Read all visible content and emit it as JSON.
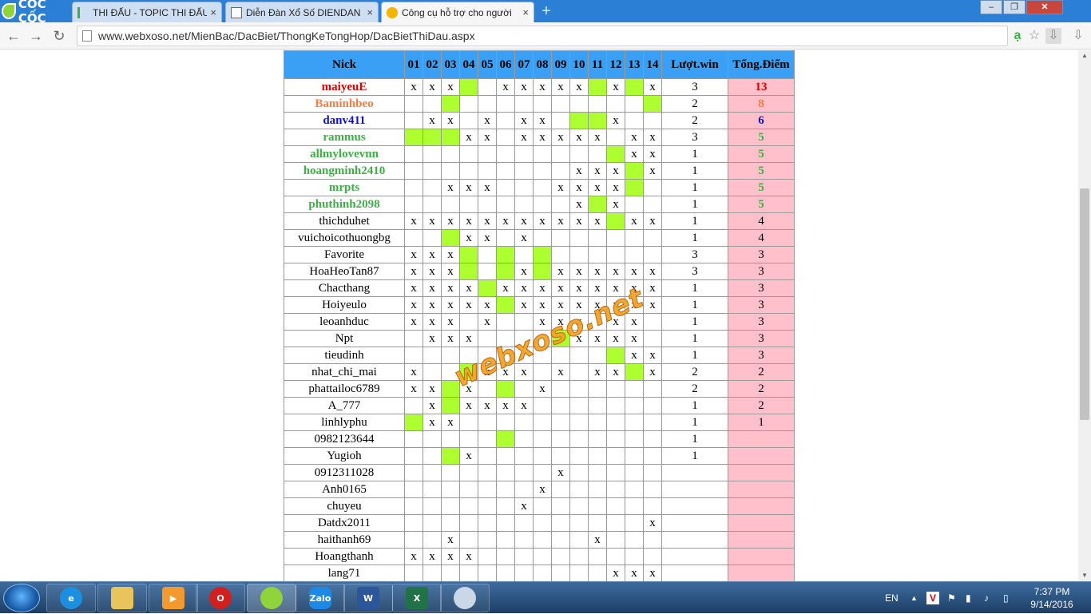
{
  "browser": {
    "brand": "CỐC CỐC",
    "tabs": [
      {
        "title": "THI ĐẤU - TOPIC THI ĐẤU",
        "close": "×"
      },
      {
        "title": "Diễn Đàn Xổ Số DIENDAN",
        "close": "×"
      },
      {
        "title": "Công cụ hỗ trợ cho người",
        "close": "×"
      }
    ],
    "new_tab": "+",
    "url": "www.webxoso.net/MienBac/DacBiet/ThongKeTongHop/DacBietThiDau.aspx",
    "window_controls": {
      "minimize": "–",
      "maximize": "❐",
      "close": "✕"
    }
  },
  "table": {
    "headers": {
      "nick": "Nick",
      "days": [
        "01",
        "02",
        "03",
        "04",
        "05",
        "06",
        "07",
        "08",
        "09",
        "10",
        "11",
        "12",
        "13",
        "14"
      ],
      "wins": "Lượt.win",
      "points": "Tổng.Điểm"
    },
    "rows": [
      {
        "nick": "maiyeuE",
        "color": "#e00000",
        "bold": true,
        "cells": [
          "x",
          "x",
          "x",
          "G",
          "",
          "x",
          "x",
          "x",
          "x",
          "x",
          "G",
          "x",
          "G",
          "x"
        ],
        "wins": "3",
        "points": "13"
      },
      {
        "nick": "Baminhbeo",
        "color": "#ff7a3d",
        "bold": true,
        "cells": [
          "",
          "",
          "G",
          "",
          "",
          "",
          "",
          "",
          "",
          "",
          "",
          "",
          "",
          "G"
        ],
        "wins": "2",
        "points": "8"
      },
      {
        "nick": "danv411",
        "color": "#1010c8",
        "bold": true,
        "cells": [
          "",
          "x",
          "x",
          "",
          "x",
          "",
          "x",
          "x",
          "",
          "G",
          "G",
          "x",
          "",
          ""
        ],
        "wins": "2",
        "points": "6"
      },
      {
        "nick": "rammus",
        "color": "#3cb043",
        "bold": true,
        "cells": [
          "G",
          "G",
          "G",
          "x",
          "x",
          "",
          "x",
          "x",
          "x",
          "x",
          "x",
          "",
          "x",
          "x"
        ],
        "wins": "3",
        "points": "5"
      },
      {
        "nick": "allmylovevnn",
        "color": "#3cb043",
        "bold": true,
        "cells": [
          "",
          "",
          "",
          "",
          "",
          "",
          "",
          "",
          "",
          "",
          "",
          "G",
          "x",
          "x"
        ],
        "wins": "1",
        "points": "5"
      },
      {
        "nick": "hoangminh2410",
        "color": "#3cb043",
        "bold": true,
        "cells": [
          "",
          "",
          "",
          "",
          "",
          "",
          "",
          "",
          "",
          "x",
          "x",
          "x",
          "G",
          "x"
        ],
        "wins": "1",
        "points": "5"
      },
      {
        "nick": "mrpts",
        "color": "#3cb043",
        "bold": true,
        "cells": [
          "",
          "",
          "x",
          "x",
          "x",
          "",
          "",
          "",
          "x",
          "x",
          "x",
          "x",
          "G",
          ""
        ],
        "wins": "1",
        "points": "5"
      },
      {
        "nick": "phuthinh2098",
        "color": "#3cb043",
        "bold": true,
        "cells": [
          "",
          "",
          "",
          "",
          "",
          "",
          "",
          "",
          "",
          "x",
          "G",
          "x",
          "",
          ""
        ],
        "wins": "1",
        "points": "5"
      },
      {
        "nick": "thichduhet",
        "color": "#000",
        "bold": false,
        "cells": [
          "x",
          "x",
          "x",
          "x",
          "x",
          "x",
          "x",
          "x",
          "x",
          "x",
          "x",
          "G",
          "x",
          "x"
        ],
        "wins": "1",
        "points": "4"
      },
      {
        "nick": "vuichoicothuongbg",
        "color": "#000",
        "bold": false,
        "cells": [
          "",
          "",
          "G",
          "x",
          "x",
          "",
          "x",
          "",
          "",
          "",
          "",
          "",
          "",
          ""
        ],
        "wins": "1",
        "points": "4"
      },
      {
        "nick": "Favorite",
        "color": "#000",
        "bold": false,
        "cells": [
          "x",
          "x",
          "x",
          "G",
          "",
          "G",
          "",
          "G",
          "",
          "",
          "",
          "",
          "",
          ""
        ],
        "wins": "3",
        "points": "3"
      },
      {
        "nick": "HoaHeoTan87",
        "color": "#000",
        "bold": false,
        "cells": [
          "x",
          "x",
          "x",
          "G",
          "",
          "G",
          "x",
          "G",
          "x",
          "x",
          "x",
          "x",
          "x",
          "x"
        ],
        "wins": "3",
        "points": "3"
      },
      {
        "nick": "Chacthang",
        "color": "#000",
        "bold": false,
        "cells": [
          "x",
          "x",
          "x",
          "x",
          "G",
          "x",
          "x",
          "x",
          "x",
          "x",
          "x",
          "x",
          "x",
          "x"
        ],
        "wins": "1",
        "points": "3"
      },
      {
        "nick": "Hoiyeulo",
        "color": "#000",
        "bold": false,
        "cells": [
          "x",
          "x",
          "x",
          "x",
          "x",
          "G",
          "x",
          "x",
          "x",
          "x",
          "x",
          "x",
          "x",
          "x"
        ],
        "wins": "1",
        "points": "3"
      },
      {
        "nick": "leoanhduc",
        "color": "#000",
        "bold": false,
        "cells": [
          "x",
          "x",
          "x",
          "",
          "x",
          "",
          "",
          "x",
          "x",
          "x",
          "",
          "x",
          "x",
          ""
        ],
        "wins": "1",
        "points": "3"
      },
      {
        "nick": "Npt",
        "color": "#000",
        "bold": false,
        "cells": [
          "",
          "x",
          "x",
          "x",
          "",
          "",
          "",
          "",
          "G",
          "x",
          "x",
          "x",
          "x",
          ""
        ],
        "wins": "1",
        "points": "3"
      },
      {
        "nick": "tieudinh",
        "color": "#000",
        "bold": false,
        "cells": [
          "",
          "",
          "",
          "",
          "",
          "",
          "",
          "",
          "",
          "",
          "",
          "G",
          "x",
          "x"
        ],
        "wins": "1",
        "points": "3"
      },
      {
        "nick": "nhat_chi_mai",
        "color": "#000",
        "bold": false,
        "cells": [
          "x",
          "",
          "",
          "G",
          "x",
          "x",
          "x",
          "",
          "x",
          "",
          "x",
          "x",
          "G",
          "x"
        ],
        "wins": "2",
        "points": "2"
      },
      {
        "nick": "phattailoc6789",
        "color": "#000",
        "bold": false,
        "cells": [
          "x",
          "x",
          "G",
          "x",
          "",
          "G",
          "",
          "x",
          "",
          "",
          "",
          "",
          "",
          ""
        ],
        "wins": "2",
        "points": "2"
      },
      {
        "nick": "A_777",
        "color": "#000",
        "bold": false,
        "cells": [
          "",
          "x",
          "G",
          "x",
          "x",
          "x",
          "x",
          "",
          "",
          "",
          "",
          "",
          "",
          ""
        ],
        "wins": "1",
        "points": "2"
      },
      {
        "nick": "linhlyphu",
        "color": "#000",
        "bold": false,
        "cells": [
          "G",
          "x",
          "x",
          "",
          "",
          "",
          "",
          "",
          "",
          "",
          "",
          "",
          "",
          ""
        ],
        "wins": "1",
        "points": "1"
      },
      {
        "nick": "0982123644",
        "color": "#000",
        "bold": false,
        "cells": [
          "",
          "",
          "",
          "",
          "",
          "G",
          "",
          "",
          "",
          "",
          "",
          "",
          "",
          ""
        ],
        "wins": "1",
        "points": ""
      },
      {
        "nick": "Yugioh",
        "color": "#000",
        "bold": false,
        "cells": [
          "",
          "",
          "G",
          "x",
          "",
          "",
          "",
          "",
          "",
          "",
          "",
          "",
          "",
          ""
        ],
        "wins": "1",
        "points": ""
      },
      {
        "nick": "0912311028",
        "color": "#000",
        "bold": false,
        "cells": [
          "",
          "",
          "",
          "",
          "",
          "",
          "",
          "",
          "x",
          "",
          "",
          "",
          "",
          ""
        ],
        "wins": "",
        "points": ""
      },
      {
        "nick": "Anh0165",
        "color": "#000",
        "bold": false,
        "cells": [
          "",
          "",
          "",
          "",
          "",
          "",
          "",
          "x",
          "",
          "",
          "",
          "",
          "",
          ""
        ],
        "wins": "",
        "points": ""
      },
      {
        "nick": "chuyeu",
        "color": "#000",
        "bold": false,
        "cells": [
          "",
          "",
          "",
          "",
          "",
          "",
          "x",
          "",
          "",
          "",
          "",
          "",
          "",
          ""
        ],
        "wins": "",
        "points": ""
      },
      {
        "nick": "Datdx2011",
        "color": "#000",
        "bold": false,
        "cells": [
          "",
          "",
          "",
          "",
          "",
          "",
          "",
          "",
          "",
          "",
          "",
          "",
          "",
          "x"
        ],
        "wins": "",
        "points": ""
      },
      {
        "nick": "haithanh69",
        "color": "#000",
        "bold": false,
        "cells": [
          "",
          "",
          "x",
          "",
          "",
          "",
          "",
          "",
          "",
          "",
          "x",
          "",
          "",
          ""
        ],
        "wins": "",
        "points": ""
      },
      {
        "nick": "Hoangthanh",
        "color": "#000",
        "bold": false,
        "cells": [
          "x",
          "x",
          "x",
          "x",
          "",
          "",
          "",
          "",
          "",
          "",
          "",
          "",
          "",
          ""
        ],
        "wins": "",
        "points": ""
      },
      {
        "nick": "lang71",
        "color": "#000",
        "bold": false,
        "cells": [
          "",
          "",
          "",
          "",
          "",
          "",
          "",
          "",
          "",
          "",
          "",
          "x",
          "x",
          "x"
        ],
        "wins": "",
        "points": ""
      }
    ],
    "win_cell_color": "#adff2f",
    "header_color": "#3aa0f5",
    "points_color": "#ffc0cb"
  },
  "watermark": "webxoso.net",
  "taskbar": {
    "apps": [
      "ie-icon",
      "explorer-icon",
      "media-icon",
      "opera-icon",
      "coccoc-icon",
      "zalo-icon",
      "word-icon",
      "excel-icon",
      "paint-icon"
    ],
    "zalo": "Zalo",
    "word": "W",
    "excel": "X",
    "language": "EN",
    "time": "7:37 PM",
    "date": "9/14/2016"
  }
}
